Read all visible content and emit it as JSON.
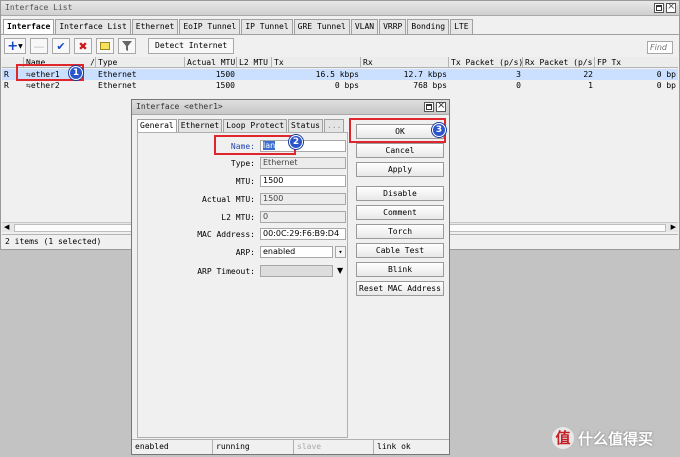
{
  "list_window": {
    "title": "Interface List",
    "tabs": [
      "Interface",
      "Interface List",
      "Ethernet",
      "EoIP Tunnel",
      "IP Tunnel",
      "GRE Tunnel",
      "VLAN",
      "VRRP",
      "Bonding",
      "LTE"
    ],
    "toolbar": {
      "add": "+",
      "detect_label": "Detect Internet",
      "find_placeholder": "Find"
    },
    "columns": [
      "Name",
      "Type",
      "Actual MTU",
      "L2 MTU",
      "Tx",
      "Rx",
      "Tx Packet (p/s)",
      "Rx Packet (p/s)",
      "FP Tx"
    ],
    "rows": [
      {
        "flag": "R",
        "name": "ether1",
        "type": "Ethernet",
        "actual_mtu": "1500",
        "l2_mtu": "",
        "tx": "16.5 kbps",
        "rx": "12.7 kbps",
        "tx_packet": "3",
        "rx_packet": "22",
        "fp_tx": "0 bp"
      },
      {
        "flag": "R",
        "name": "ether2",
        "type": "Ethernet",
        "actual_mtu": "1500",
        "l2_mtu": "",
        "tx": "0 bps",
        "rx": "768 bps",
        "tx_packet": "0",
        "rx_packet": "1",
        "fp_tx": "0 bp"
      }
    ],
    "status": "2 items (1 selected)"
  },
  "dialog": {
    "title": "Interface <ether1>",
    "tabs": [
      "General",
      "Ethernet",
      "Loop Protect",
      "Status",
      "..."
    ],
    "fields": {
      "name": {
        "label": "Name:",
        "value": "lan"
      },
      "type": {
        "label": "Type:",
        "value": "Ethernet"
      },
      "mtu": {
        "label": "MTU:",
        "value": "1500"
      },
      "actual_mtu": {
        "label": "Actual MTU:",
        "value": "1500"
      },
      "l2_mtu": {
        "label": "L2 MTU:",
        "value": "0"
      },
      "mac": {
        "label": "MAC Address:",
        "value": "00:0C:29:F6:B9:D4"
      },
      "arp": {
        "label": "ARP:",
        "value": "enabled"
      },
      "arp_timeout": {
        "label": "ARP Timeout:",
        "value": ""
      }
    },
    "buttons": [
      "OK",
      "Cancel",
      "Apply",
      "Disable",
      "Comment",
      "Torch",
      "Cable Test",
      "Blink",
      "Reset MAC Address"
    ],
    "status": [
      "enabled",
      "running",
      "slave",
      "link ok"
    ]
  },
  "annotations": {
    "marker1": "1",
    "marker2": "2",
    "marker3": "3"
  },
  "watermark": {
    "logo": "值",
    "text": "什么值得买"
  }
}
